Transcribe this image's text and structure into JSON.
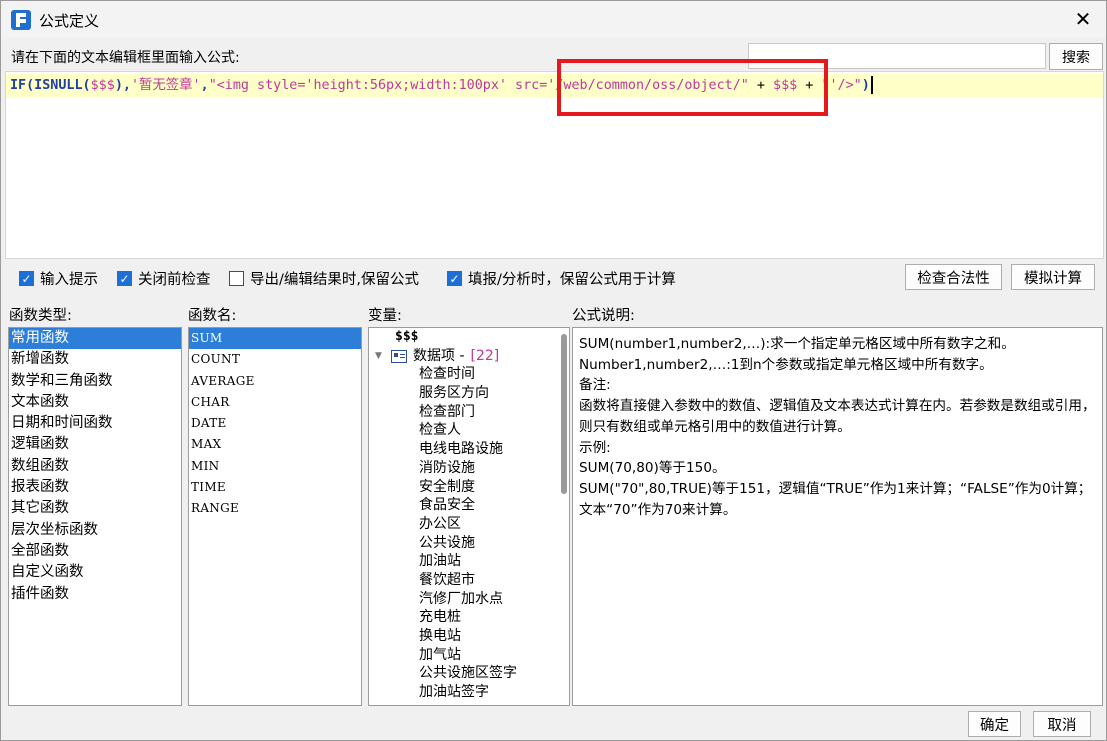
{
  "window": {
    "title": "公式定义",
    "close_glyph": "✕"
  },
  "prompt": {
    "label": "请在下面的文本编辑框里面输入公式:"
  },
  "search": {
    "value": "",
    "button_label": "搜索"
  },
  "editor": {
    "tokens": [
      {
        "t": "IF(ISNULL(",
        "k": "kw"
      },
      {
        "t": "$$$",
        "k": "var"
      },
      {
        "t": "),",
        "k": "kw"
      },
      {
        "t": "'暂无签章'",
        "k": "str"
      },
      {
        "t": ",",
        "k": "kw"
      },
      {
        "t": "\"<img style='height:56px;width:100px' src='/web/common/oss/object/\"",
        "k": "str"
      },
      {
        "t": " + ",
        "k": "op"
      },
      {
        "t": "$$$",
        "k": "var"
      },
      {
        "t": " + ",
        "k": "op"
      },
      {
        "t": "\"'/>\"",
        "k": "str"
      },
      {
        "t": ")",
        "k": "kw"
      }
    ],
    "highlight_color": "#e5191c"
  },
  "options": {
    "input_hint": {
      "label": "输入提示",
      "checked": true
    },
    "check_before_close": {
      "label": "关闭前检查",
      "checked": true
    },
    "keep_formula_on_export": {
      "label": "导出/编辑结果时,保留公式",
      "checked": false
    },
    "keep_formula_on_fill": {
      "label": "填报/分析时，保留公式用于计算",
      "checked": true
    }
  },
  "buttons": {
    "validate": "检查合法性",
    "simulate": "模拟计算",
    "ok": "确定",
    "cancel": "取消"
  },
  "function_types": {
    "label": "函数类型:",
    "items": [
      "常用函数",
      "新增函数",
      "数学和三角函数",
      "文本函数",
      "日期和时间函数",
      "逻辑函数",
      "数组函数",
      "报表函数",
      "其它函数",
      "层次坐标函数",
      "全部函数",
      "自定义函数",
      "插件函数"
    ],
    "selected": 0
  },
  "function_names": {
    "label": "函数名:",
    "items": [
      "SUM",
      "COUNT",
      "AVERAGE",
      "CHAR",
      "DATE",
      "MAX",
      "MIN",
      "TIME",
      "RANGE"
    ],
    "selected": 0
  },
  "variables": {
    "label": "变量:",
    "root": "$$$",
    "group_label": "数据项 - ",
    "group_count": "[22]",
    "items": [
      "检查时间",
      "服务区方向",
      "检查部门",
      "检查人",
      "电线电路设施",
      "消防设施",
      "安全制度",
      "食品安全",
      "办公区",
      "公共设施",
      "加油站",
      "餐饮超市",
      "汽修厂加水点",
      "充电桩",
      "换电站",
      "加气站",
      "公共设施区签字",
      "加油站签字"
    ]
  },
  "description": {
    "label": "公式说明:",
    "lines": [
      "SUM(number1,number2,…):求一个指定单元格区域中所有数字之和。",
      "Number1,number2,…:1到n个参数或指定单元格区域中所有数字。",
      "备注:",
      "函数将直接健入参数中的数值、逻辑值及文本表达式计算在内。若参数是数组或引用，则只有数组或单元格引用中的数值进行计算。",
      "示例:",
      "SUM(70,80)等于150。",
      "SUM(\"70\",80,TRUE)等于151，逻辑值“TRUE”作为1来计算；“FALSE”作为0计算；文本“70”作为70来计算。"
    ]
  },
  "colors": {
    "selection": "#2d7ed9",
    "editor_line_bg": "#ffffc8",
    "keyword": "#1f3fa6",
    "string": "#c0399a"
  }
}
